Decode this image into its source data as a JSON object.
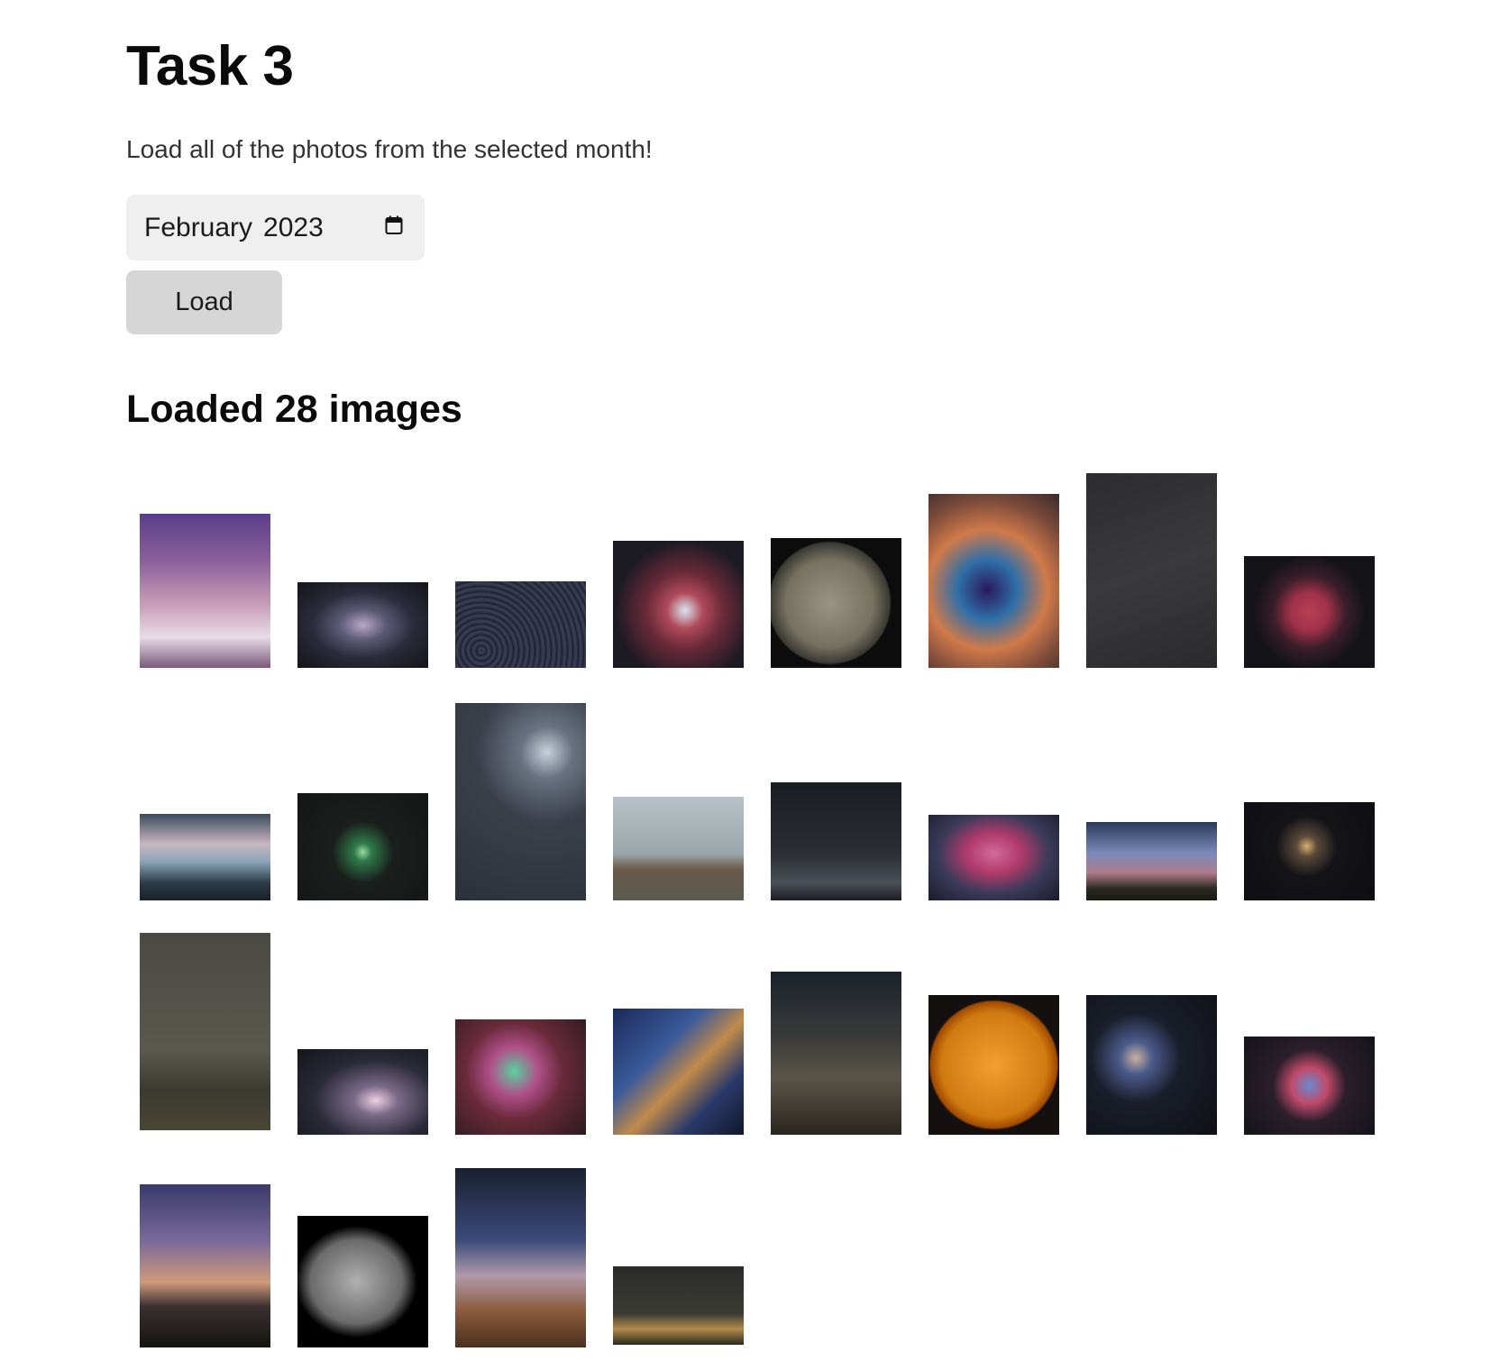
{
  "heading": "Task 3",
  "instructions": "Load all of the photos from the selected month!",
  "month_input": {
    "month": "February",
    "year": "2023",
    "icon": "calendar-icon"
  },
  "load_button_label": "Load",
  "result_heading": "Loaded 28 images",
  "images": [
    {
      "bg": "linear-gradient(180deg,#5a3e8a 0%,#8a5f9a 30%,#c9a0b8 60%,#e8dce8 80%,#7a5a7a 100%)"
    },
    {
      "bg": "radial-gradient(ellipse at 50% 50%,#b9a7c9 0%,#5d5a78 25%,#2a2a3a 55%,#141418 100%)"
    },
    {
      "bg": "repeating-radial-gradient(circle at 20% 80%,#2a2c40 0px,#3b3f5a 3px,#1a1c2a 6px)"
    },
    {
      "bg": "radial-gradient(circle at 55% 55%,#d9e6f0 0%,#b04a5a 18%,#6a2a3a 38%,#1c1a22 70%)"
    },
    {
      "bg": "radial-gradient(circle at 45% 50%,#9a9582 0%,#77725f 45%,#3a3a34 62%,#0c0c0c 64%)"
    },
    {
      "bg": "radial-gradient(circle at 45% 55%,#2a1a5a 0%,#2f6fa8 25%,#d07a4a 50%,#7a4a3a 75%,#3a2a2a 100%)"
    },
    {
      "bg": "linear-gradient(160deg,#2c2c2e 0%,#3a3a3c 50%,#2a2a2c 100%)"
    },
    {
      "bg": "radial-gradient(circle at 50% 50%,#b8404e 0%,#a0304a 22%,#3a1e2a 42%,#141418 65%)"
    },
    {
      "bg": "linear-gradient(180deg,#3a4a5a 0%,#c9b6c2 35%,#8aa6b8 55%,#2c3a48 80%,#1a222a 100%)"
    },
    {
      "bg": "radial-gradient(circle at 50% 55%,#9adba0 0%,#2f7a4a 10%,#1a1e1c 35%,#141616 100%)"
    },
    {
      "bg": "radial-gradient(circle at 70% 25%,#c9d0dc 0%,#6a7282 15%,#3a404a 40%,#2c3038 100%)"
    },
    {
      "bg": "linear-gradient(180deg,#b8c2c8 0%,#9aa6aa 55%,#6a5a4a 70%,#5a5a50 100%)"
    },
    {
      "bg": "linear-gradient(180deg,#1a1e22 0%,#2a2e32 60%,#4a5058 85%,#1a1c20 100%)"
    },
    {
      "bg": "radial-gradient(ellipse at 50% 45%,#d06a9a 0%,#b03a6a 30%,#3a3a5a 60%,#1a1c2a 100%)"
    },
    {
      "bg": "linear-gradient(180deg,#2a3a5a 0%,#7a8aba 40%,#b07a8a 65%,#2a2a22 85%,#1a1a14 100%)"
    },
    {
      "bg": "radial-gradient(circle at 48% 45%,#d8b070 0%,#5a4a3a 12%,#141418 35%,#0e0e12 100%)"
    },
    {
      "bg": "linear-gradient(180deg,#4a4a44 0%,#5a584e 60%,#3a3a30 80%,#4a4634 100%)"
    },
    {
      "bg": "radial-gradient(ellipse at 60% 60%,#f0d0e0 0%,#7a6a8a 20%,#2a2a38 55%,#141418 100%)"
    },
    {
      "bg": "radial-gradient(circle at 45% 45%,#5ad0a0 0%,#b0508a 25%,#6a2a3a 50%,#2a1a1e 100%)"
    },
    {
      "bg": "linear-gradient(135deg,#1a2a5a 0%,#3a5a9a 35%,#c08a4a 55%,#2a3a6a 75%,#101828 100%)"
    },
    {
      "bg": "linear-gradient(180deg,#1a222a 0%,#3a3a3a 40%,#5a5448 65%,#2a2620 100%)"
    },
    {
      "bg": "radial-gradient(circle at 50% 50%,#f0a030 0%,#d07a10 55%,#a04a00 66%,#141010 68%)"
    },
    {
      "bg": "radial-gradient(circle at 38% 45%,#c9b0a0 0%,#4a5a8a 15%,#1a1e2a 40%,#0e1014 100%)"
    },
    {
      "bg": "radial-gradient(circle at 50% 50%,#6a8ad0 0%,#c04a6a 22%,#2a1e2a 45%,#141418 100%)"
    },
    {
      "bg": "linear-gradient(180deg,#3a3a6a 0%,#7a6a9a 35%,#d09a7a 60%,#3a3030 75%,#141410 100%)"
    },
    {
      "bg": "radial-gradient(ellipse at 45% 50%,#b0b0b0 0%,#6a6a6a 45%,#000000 60%)"
    },
    {
      "bg": "linear-gradient(180deg,#1a2030 0%,#3a4a7a 40%,#b09aaa 60%,#8a5a3a 80%,#4a3020 100%)"
    },
    {
      "bg": "linear-gradient(180deg,#2a2a2a 0%,#3a3a34 60%,#b08a4a 80%,#2a2a20 100%)"
    }
  ]
}
